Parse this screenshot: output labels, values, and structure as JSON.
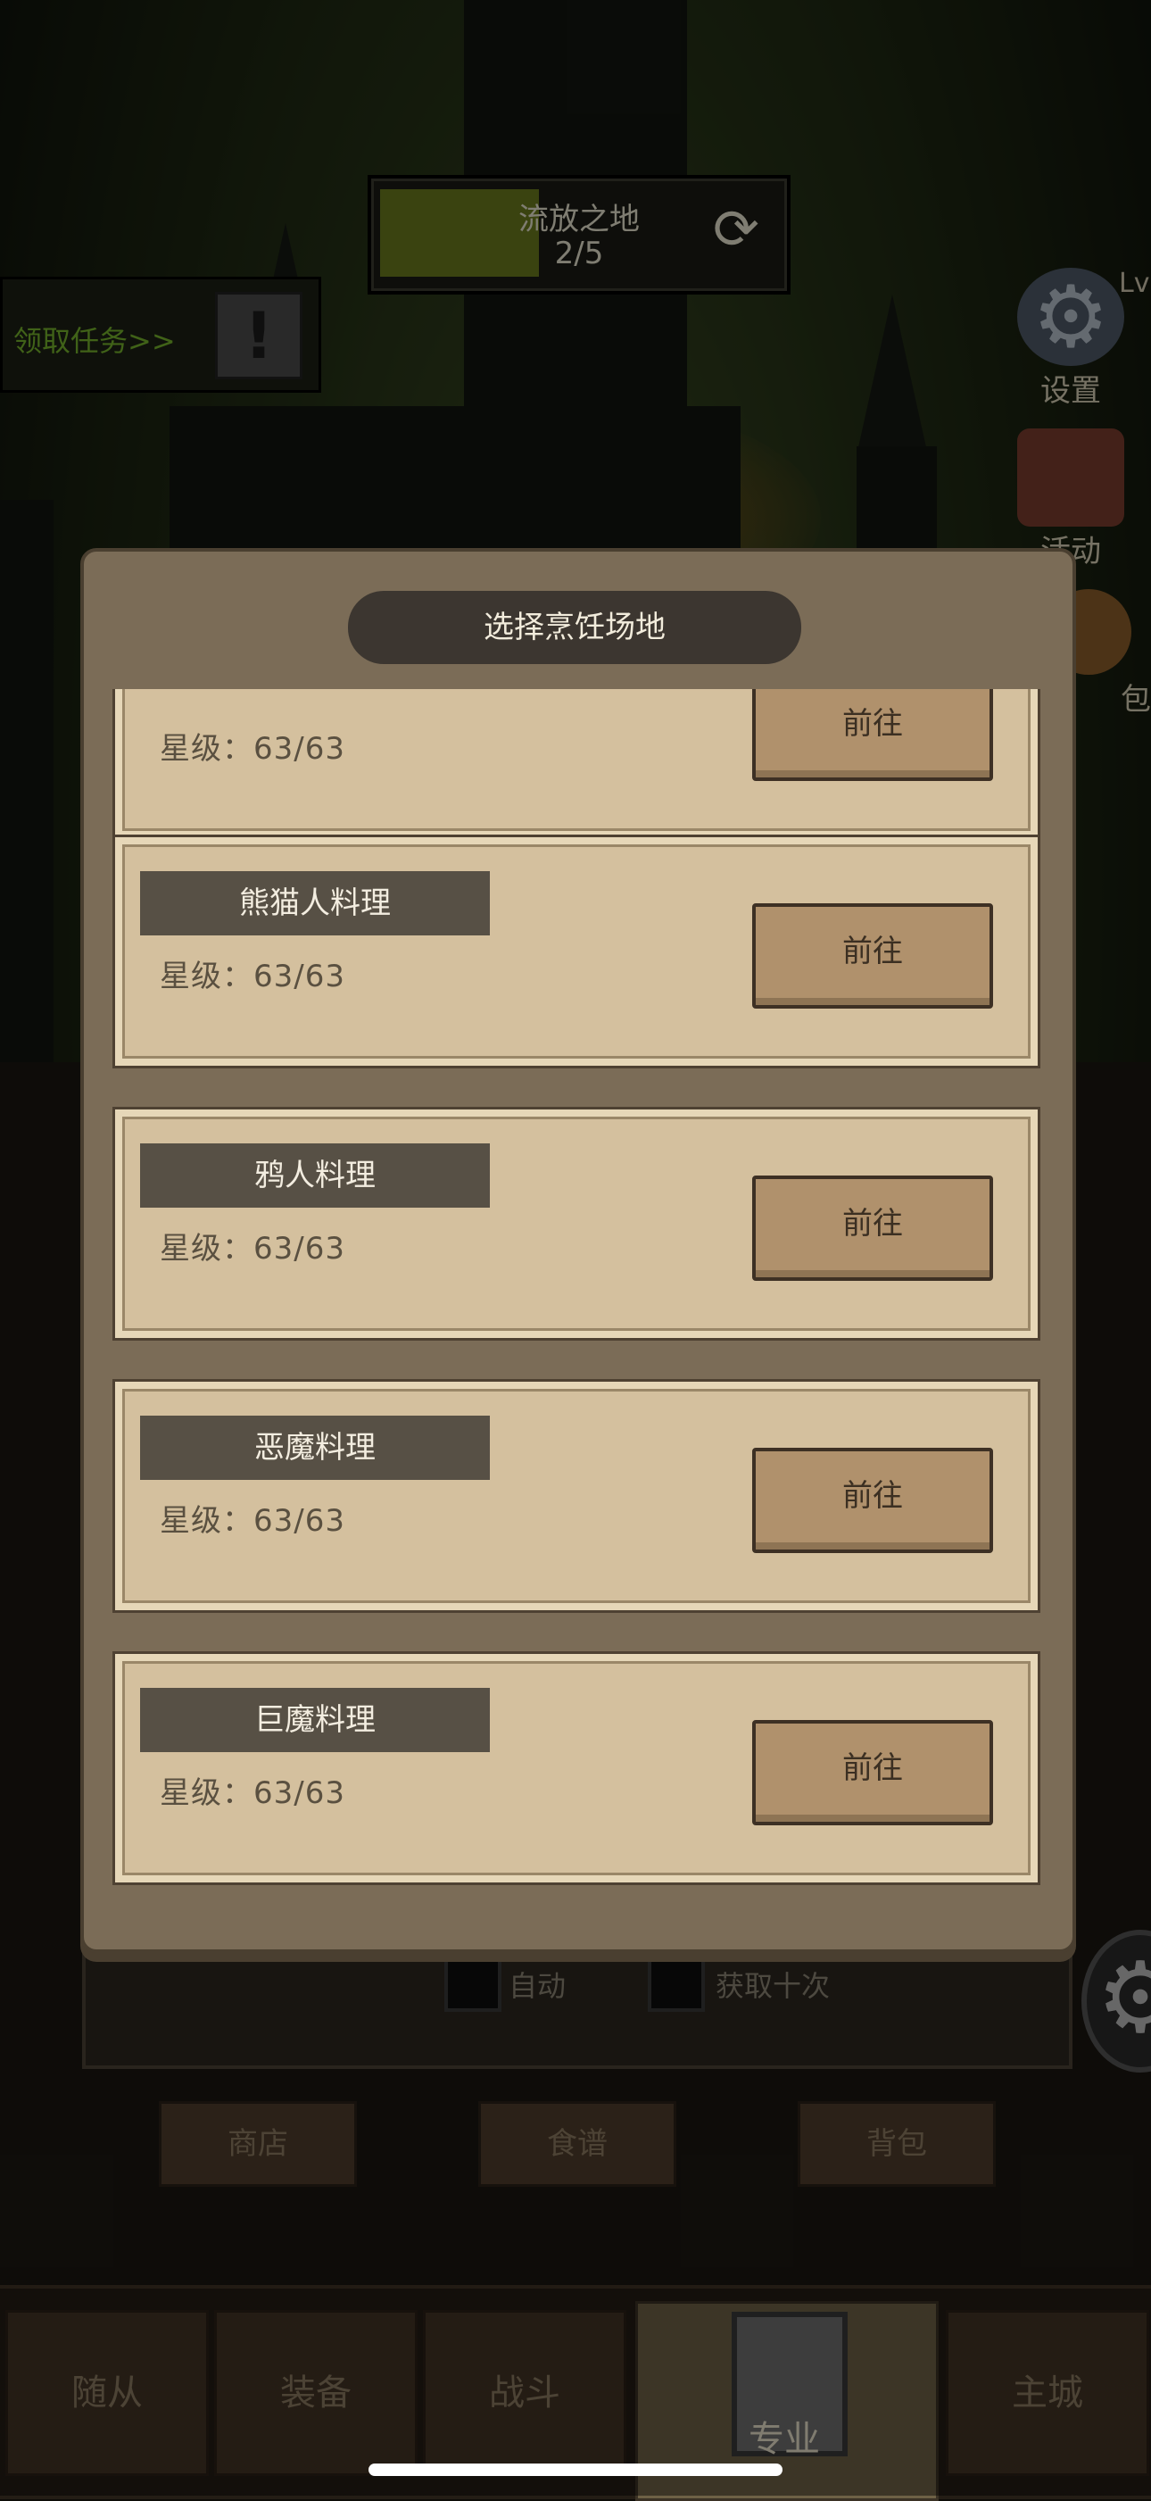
{
  "zone": {
    "name": "流放之地",
    "progress": "2/5",
    "progress_fraction": 0.4,
    "refresh_icon": "refresh-icon"
  },
  "quest": {
    "label": "领取任务>>",
    "icon": "exclamation-icon"
  },
  "side_menu": {
    "level_prefix": "Lv",
    "settings": "设置",
    "activity": "活动",
    "bag_partial": "包"
  },
  "behind_panel": {
    "auto_label": "自动",
    "ten_times_label": "获取十次",
    "shop": "商店",
    "recipes": "食谱",
    "backpack": "背包"
  },
  "nav": {
    "followers": "随从",
    "equipment": "装备",
    "battle": "战斗",
    "profession": "专业",
    "main_city": "主城"
  },
  "modal": {
    "title": "选择烹饪场地",
    "cards": [
      {
        "name": "",
        "stars": "星级：63/63",
        "button": "前往"
      },
      {
        "name": "熊猫人料理",
        "stars": "星级：63/63",
        "button": "前往"
      },
      {
        "name": "鸦人料理",
        "stars": "星级：63/63",
        "button": "前往"
      },
      {
        "name": "恶魔料理",
        "stars": "星级：63/63",
        "button": "前往"
      },
      {
        "name": "巨魔料理",
        "stars": "星级：63/63",
        "button": "前往"
      }
    ]
  },
  "colors": {
    "modal_bg": "#7b6c57",
    "card_bg": "#d4c09e",
    "button_bg": "#b0916c",
    "quest_text": "#76b32d"
  }
}
